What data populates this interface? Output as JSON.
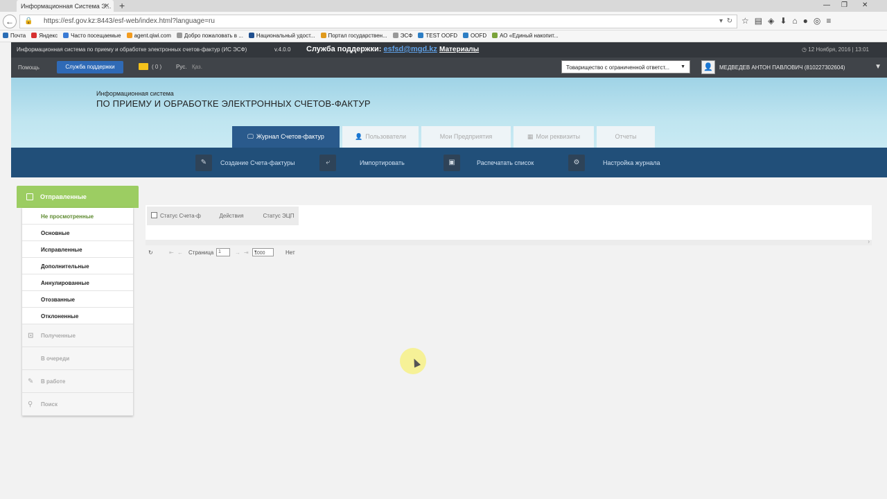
{
  "browser": {
    "tab_title": "Информационная Система Э...",
    "url": "https://esf.gov.kz:8443/esf-web/index.html?language=ru",
    "bookmarks": [
      {
        "label": "Почта",
        "color": "#2a6db5"
      },
      {
        "label": "Яндекс",
        "color": "#d62f2f"
      },
      {
        "label": "Часто посещаемые",
        "color": "#3a7bd5"
      },
      {
        "label": "agent.qiwi.com",
        "color": "#f39c1f"
      },
      {
        "label": "Добро пожаловать в ...",
        "color": "#999999"
      },
      {
        "label": "Национальный удост...",
        "color": "#1f4f8f"
      },
      {
        "label": "Портал государствен...",
        "color": "#e09a1d"
      },
      {
        "label": "ЭСФ",
        "color": "#999999"
      },
      {
        "label": "TEST OOFD",
        "color": "#2d7ec4"
      },
      {
        "label": "OOFD",
        "color": "#2d7ec4"
      },
      {
        "label": "АО «Единый накопит...",
        "color": "#7aa33a"
      }
    ]
  },
  "header": {
    "system_name": "Информационная система по приему и обработке электронных счетов-фактур (ИС ЭСФ)",
    "version": "v.4.0.0",
    "support_label": "Служба поддержки:",
    "support_email": "esfsd@mgd.kz",
    "materials": "Материалы",
    "datetime": "12 Ноября, 2016 | 13:01"
  },
  "menu": {
    "help": "Помощь",
    "support_button": "Служба поддержки",
    "mail_count": "( 0 )",
    "lang_ru": "Рус.",
    "lang_kz": "Қаз.",
    "organization": "Товарищество с ограниченной ответст...",
    "user": "МЕДВЕДЕВ АНТОН ПАВЛОВИЧ (810227302604)"
  },
  "banner": {
    "subtitle": "Информационная система",
    "title": "ПО ПРИЕМУ И ОБРАБОТКЕ ЭЛЕКТРОННЫХ СЧЕТОВ-ФАКТУР"
  },
  "tabs": [
    {
      "label": "Журнал Счетов-фактур",
      "active": true,
      "icon": "monitor-icon"
    },
    {
      "label": "Пользователи",
      "active": false,
      "icon": "user-icon"
    },
    {
      "label": "Мои Предприятия",
      "active": false,
      "icon": ""
    },
    {
      "label": "Мои реквизиты",
      "active": false,
      "icon": "document-icon"
    },
    {
      "label": "Отчеты",
      "active": false,
      "icon": ""
    }
  ],
  "toolbar": [
    {
      "label": "Создание Счета-фактуры",
      "icon": "edit-icon"
    },
    {
      "label": "Импортировать",
      "icon": "import-icon"
    },
    {
      "label": "Распечатать список",
      "icon": "print-icon"
    },
    {
      "label": "Настройка журнала",
      "icon": "gear-icon"
    }
  ],
  "sidebar": {
    "header": "Отправленные",
    "items": [
      {
        "label": "Не просмотренные",
        "active": true
      },
      {
        "label": "Основные"
      },
      {
        "label": "Исправленные"
      },
      {
        "label": "Дополнительные"
      },
      {
        "label": "Аннулированные"
      },
      {
        "label": "Отозванные"
      },
      {
        "label": "Отклоненные"
      }
    ],
    "sections": [
      {
        "label": "Полученные",
        "icon": "inbox-icon"
      },
      {
        "label": "В очереди",
        "icon": ""
      },
      {
        "label": "В работе",
        "icon": "pencil-icon"
      },
      {
        "label": "Поиск",
        "icon": "search-icon"
      }
    ]
  },
  "grid": {
    "columns": [
      "Статус Счета-ф",
      "Действия",
      "Статус ЭЦП"
    ],
    "pager": {
      "page_label": "Страница",
      "page_value": "1",
      "page_size": "1000",
      "empty_text": "Нет"
    }
  },
  "colors": {
    "active_tab": "#2a5a8c",
    "toolbar": "#214f79",
    "sidebar_header": "#9ccd62",
    "support_button": "#2f6ab6"
  }
}
